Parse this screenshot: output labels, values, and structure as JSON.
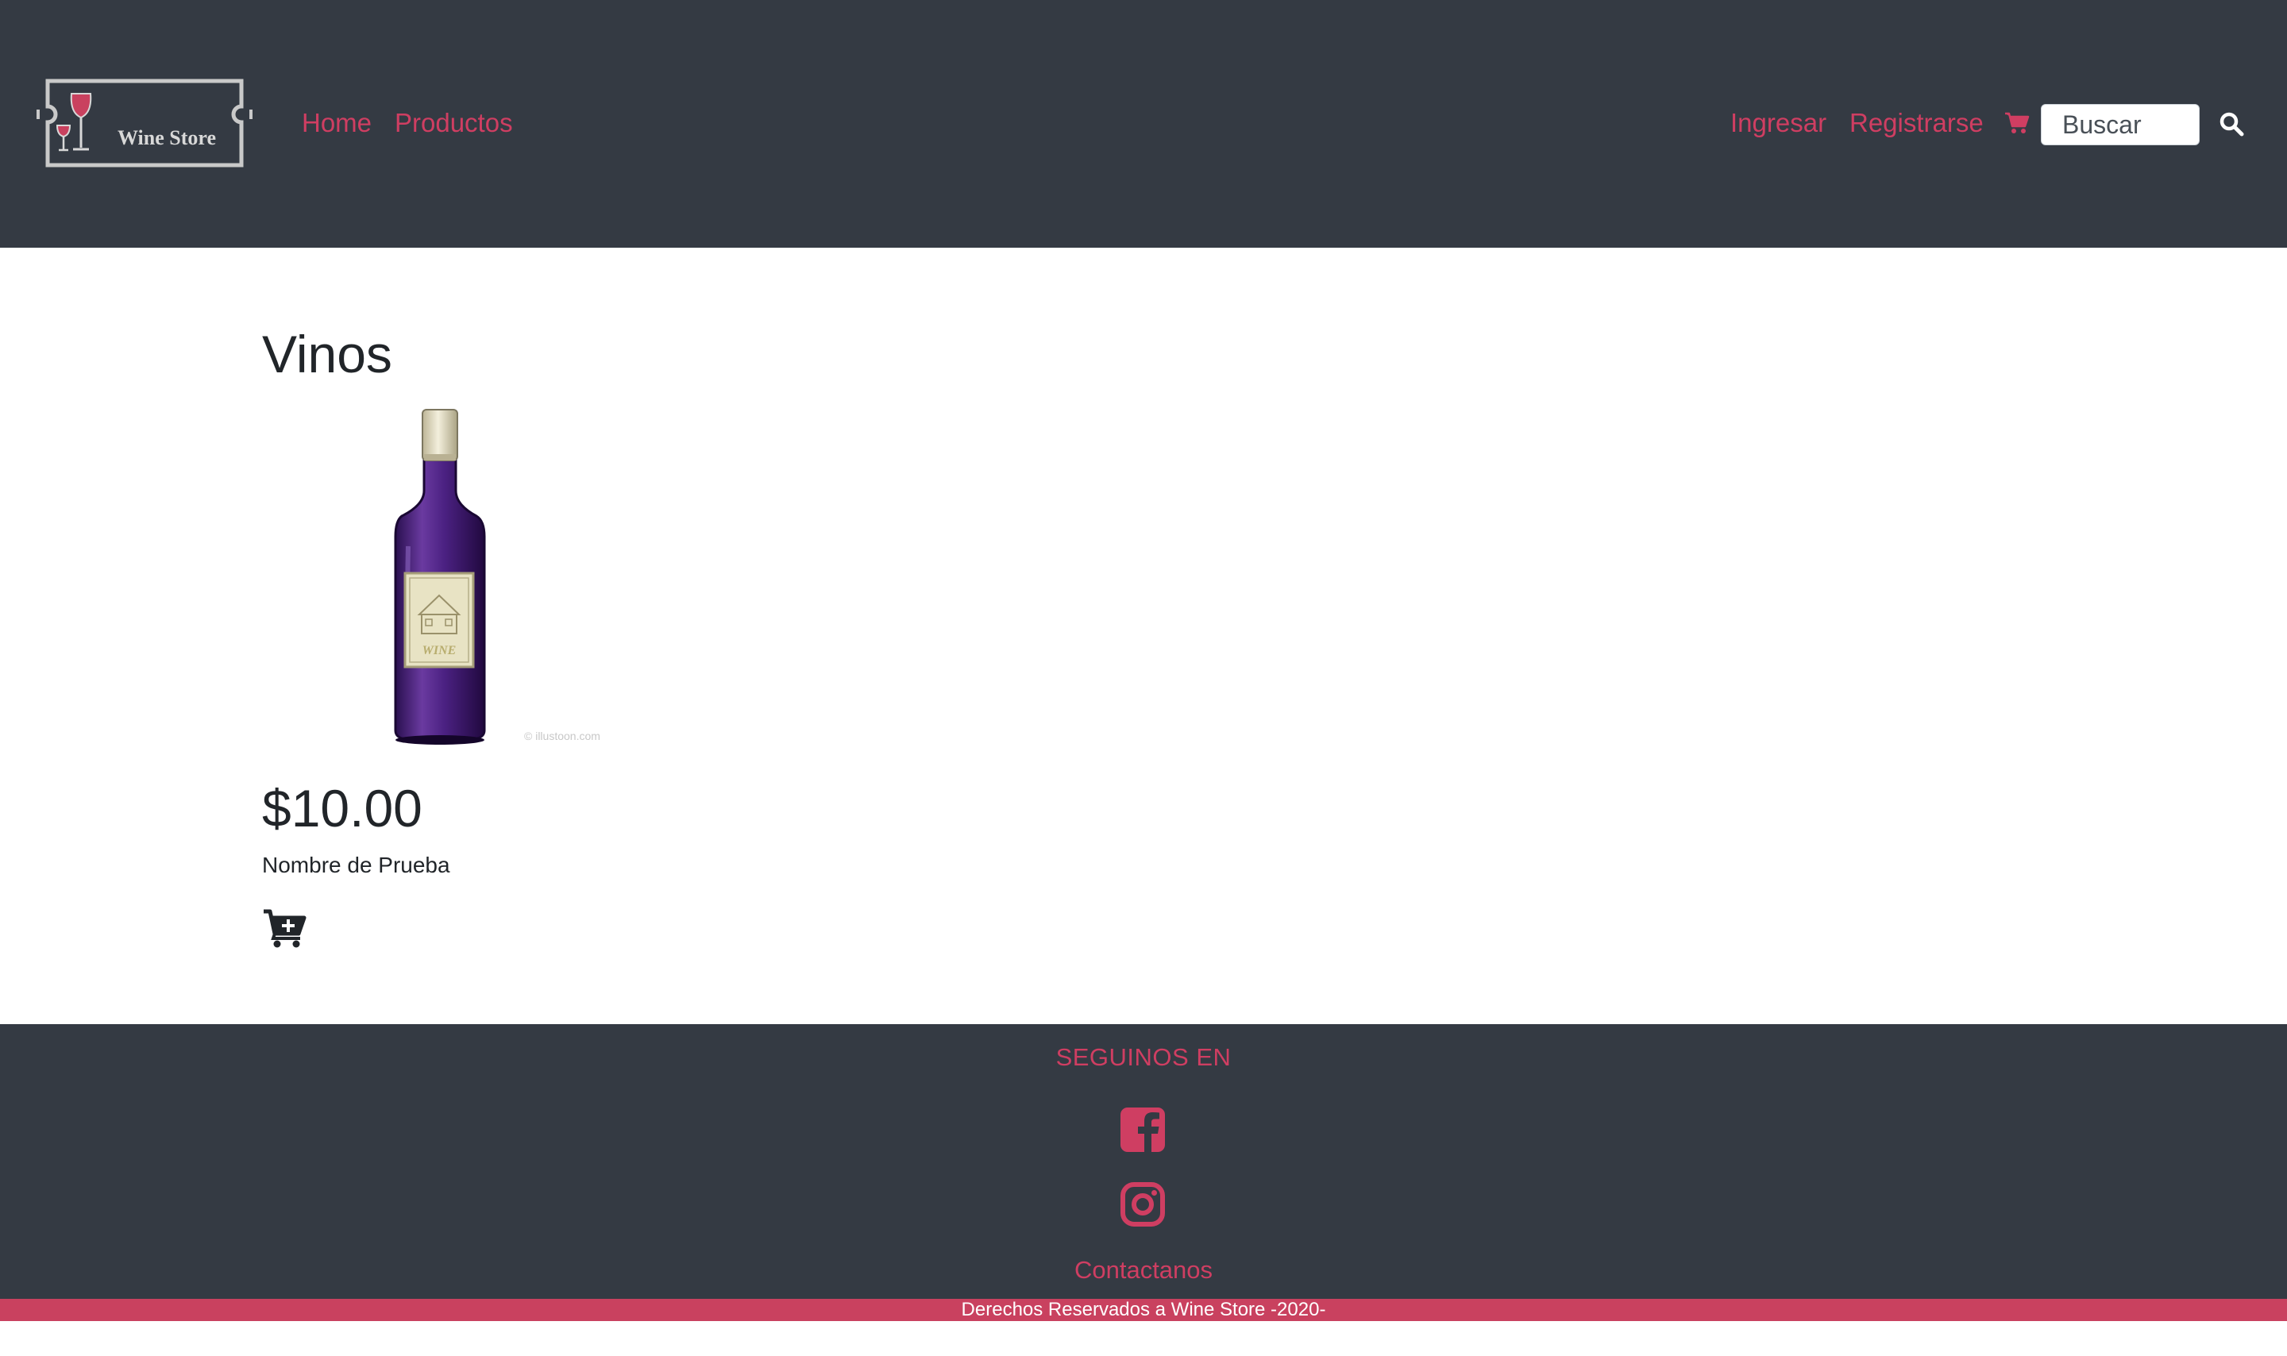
{
  "header": {
    "logo_text": "Wine Store",
    "nav": {
      "home": "Home",
      "products": "Productos",
      "login": "Ingresar",
      "register": "Registrarse"
    },
    "search": {
      "placeholder": "Buscar"
    }
  },
  "main": {
    "title": "Vinos",
    "products": [
      {
        "price": "$10.00",
        "name": "Nombre de Prueba",
        "image_watermark": "© illustoon.com"
      }
    ]
  },
  "footer": {
    "follow_label": "SEGUINOS EN",
    "contact_label": "Contactanos",
    "copyright": "Derechos Reservados a Wine Store -2020-"
  },
  "colors": {
    "navbar_bg": "#343a43",
    "accent": "#cf3e62",
    "copyright_bg": "#c9415f"
  },
  "icons": [
    "wine-glasses-logo",
    "cart-icon",
    "search-icon",
    "add-to-cart-icon",
    "facebook-icon",
    "instagram-icon"
  ]
}
